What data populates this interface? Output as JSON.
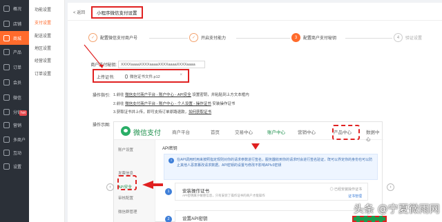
{
  "nav": {
    "items": [
      {
        "label": "概况",
        "icon": "home-icon",
        "active": false
      },
      {
        "label": "店铺",
        "icon": "store-icon",
        "active": false
      },
      {
        "label": "商城",
        "icon": "mall-icon",
        "active": true
      },
      {
        "label": "产品",
        "icon": "product-icon",
        "active": false
      },
      {
        "label": "订单",
        "icon": "order-icon",
        "active": false
      },
      {
        "label": "会员",
        "icon": "member-icon",
        "active": false
      },
      {
        "label": "微信",
        "icon": "wechat-icon",
        "active": false
      },
      {
        "label": "分销",
        "icon": "distribution-icon",
        "active": false
      },
      {
        "label": "营销",
        "icon": "marketing-icon",
        "active": false
      },
      {
        "label": "多商户",
        "icon": "merchant-icon",
        "active": false
      },
      {
        "label": "互动",
        "icon": "interact-icon",
        "active": false
      },
      {
        "label": "设置",
        "icon": "settings-icon",
        "active": false
      }
    ],
    "hot_badge": "hot"
  },
  "subnav": {
    "items": [
      "功能设置",
      "支付设置",
      "配送设置",
      "地区设置",
      "经营设置",
      "订单设置"
    ],
    "active_index": 1
  },
  "header": {
    "back": "< 返回",
    "title": "小程序微信支付设置"
  },
  "steps": [
    {
      "num": "✓",
      "label": "配置微信支付商户号",
      "state": "done"
    },
    {
      "num": "✓",
      "label": "开启支付能力",
      "state": "done"
    },
    {
      "num": "3",
      "label": "配置商户支付秘钥",
      "state": "current"
    },
    {
      "num": "4",
      "label": "验证设置",
      "state": "todo"
    }
  ],
  "form": {
    "merchant_label": "商户支付秘钥:",
    "merchant_value": "XXXXaaaaXXXXaaaaXXXXaaaaXXXXaaaa",
    "cert_label": "上传证书:",
    "cert_file": "微信证书文件.p12",
    "cert_clear": "×",
    "guide_label": "操作指引:",
    "guide_lines": [
      {
        "pre": "1.前往 ",
        "link": "微信支付商户平台 - 账户中心 - API安全",
        "post": " 设置密钥，并粘贴到上方文本框内"
      },
      {
        "pre": "2.前往 ",
        "link": "微信支付商户平台 - 账户中心 - 个人设置 - 操作证书",
        "post": " 安装操作证书"
      },
      {
        "pre": "3.获取证书并上传，即可支持订单原路退款，",
        "link": "如何获取证书",
        "post": ""
      }
    ],
    "example_label": "操作示图:"
  },
  "shot": {
    "brand": "微信支付",
    "platform": "商户平台",
    "tabs": [
      "首页",
      "交易中心",
      "账户中心",
      "营销中心",
      "产品中心",
      "数据中心"
    ],
    "active_tab": 2,
    "side": [
      "账户设置",
      "发票信息",
      "API安全",
      "审核配置",
      "微信群管理",
      "开发配置"
    ],
    "active_side": 2,
    "main_title": "API密钥",
    "info": "在API调用时用来按照指定规则对你的请求参数进行签名，服务器收到你的请求时会进行签名验证，既可以界定你的身份也可以防止其他人恶意篡改请求数据。API密钥的设置与修改不影响APIv3密钥",
    "cards": [
      {
        "num": "1",
        "title": "安装操作证书",
        "desc": "API密钥属于敏感信息，只有安装了操作证书的商户才能操作",
        "status": "◎ 已经安装操作证书",
        "link": "证书管理"
      },
      {
        "num": "2",
        "title": "设置API密钥",
        "desc": "",
        "status": "",
        "link": ""
      }
    ],
    "prev_arrow": "‹",
    "next_arrow": "›"
  },
  "watermark": "头条 @宁夏微雨网"
}
